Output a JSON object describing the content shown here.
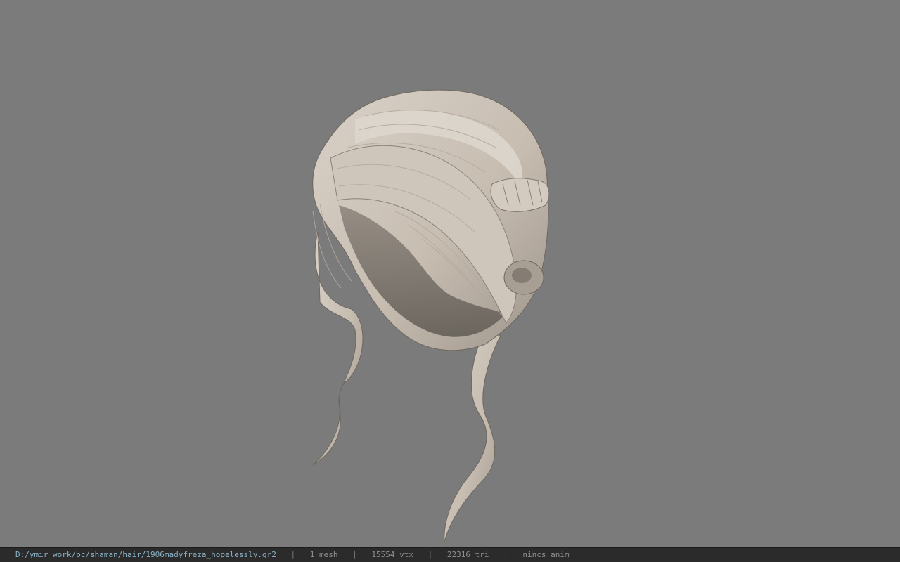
{
  "viewer": {
    "background_color": "#7b7b7b",
    "model_icon": "hair-mesh"
  },
  "status": {
    "file_path": "D:/ymir work/pc/shaman/hair/1906madyfreza_hopelessly.gr2",
    "separator": "|",
    "meshes": "1 mesh",
    "vertices": "15554 vtx",
    "triangles": "22316 tri",
    "anim": "nincs anim"
  }
}
